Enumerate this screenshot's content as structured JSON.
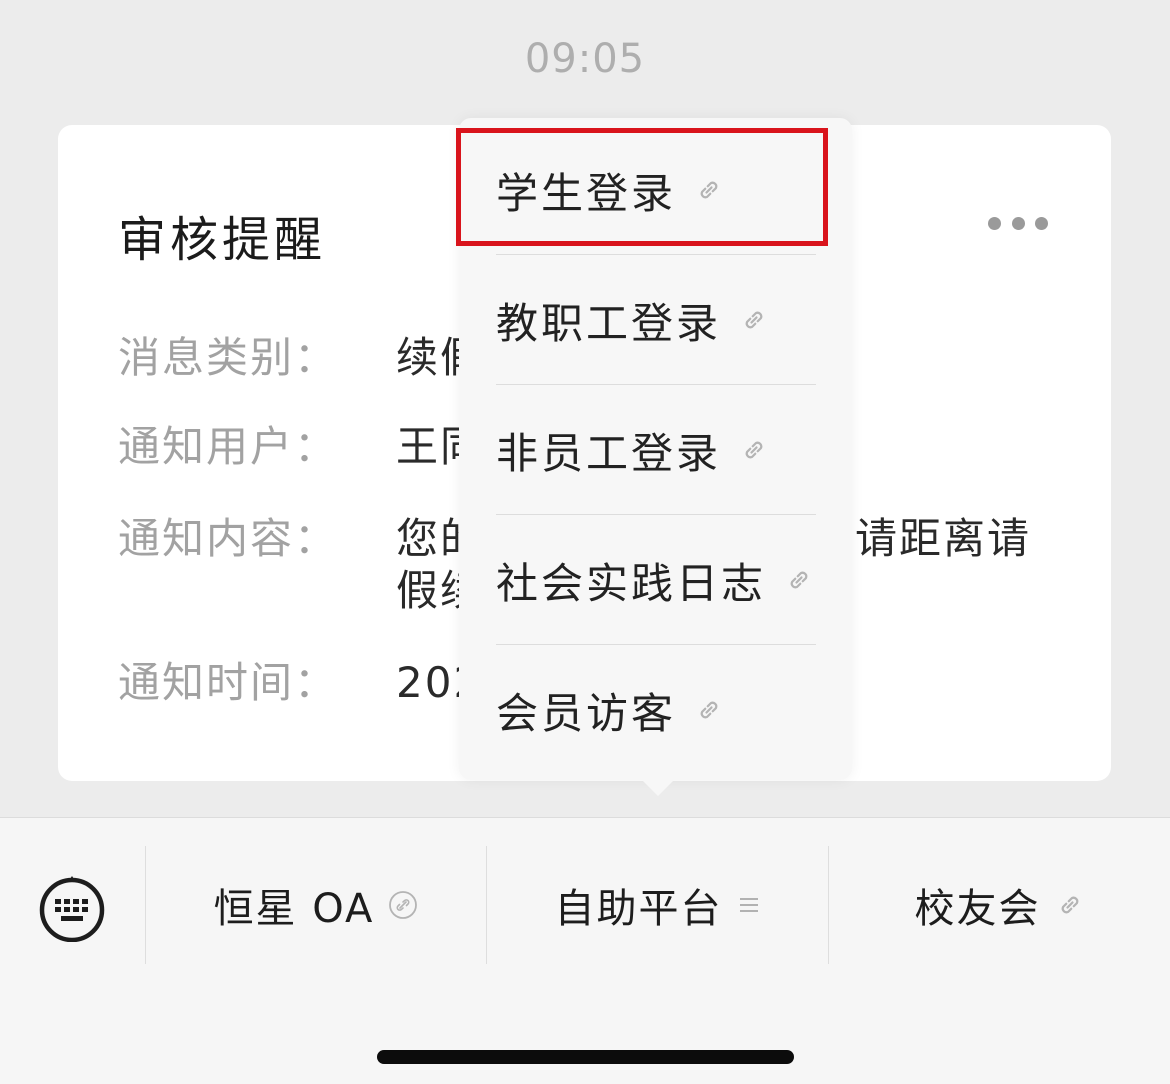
{
  "timestamp": "09:05",
  "card": {
    "title": "审核提醒",
    "rows": [
      {
        "label": "消息类别：",
        "value": "续假"
      },
      {
        "label": "通知用户：",
        "value": "王同"
      },
      {
        "label": "通知内容：",
        "value": "您的",
        "tail": "请距离请",
        "wrap": "假续"
      },
      {
        "label": "通知时间：",
        "value": "202"
      }
    ]
  },
  "popup_menu": {
    "items": [
      {
        "label": "学生登录",
        "icon": "link-icon"
      },
      {
        "label": "教职工登录",
        "icon": "link-icon"
      },
      {
        "label": "非员工登录",
        "icon": "link-icon"
      },
      {
        "label": "社会实践日志",
        "icon": "link-icon"
      },
      {
        "label": "会员访客",
        "icon": "link-icon"
      }
    ],
    "highlighted_index": 0,
    "highlight_color": "#d9141c"
  },
  "bottom_bar": {
    "keyboard_icon": "keyboard-icon",
    "tabs": [
      {
        "label": "恒星 OA",
        "icon": "link-circle-icon"
      },
      {
        "label": "自助平台",
        "icon": "menu-lines-icon"
      },
      {
        "label": "校友会",
        "icon": "link-icon"
      }
    ]
  },
  "colors": {
    "background": "#ececec",
    "card": "#ffffff",
    "popup": "#f7f7f7",
    "label_gray": "#a2a2a2",
    "text_dark": "#222222"
  }
}
